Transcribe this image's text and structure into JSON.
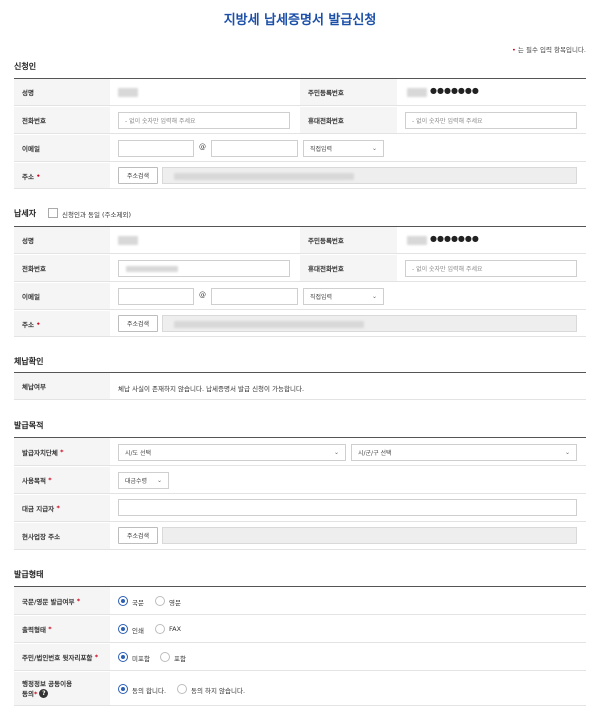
{
  "title": "지방세 납세증명서 발급신청",
  "required_note": {
    "marker": "•",
    "text": "는 필수 입력 항목입니다."
  },
  "applicant": {
    "section": "신청인",
    "name_label": "성명",
    "rrn_label": "주민등록번호",
    "rrn_mask": "●●●●●●●",
    "phone_label": "전화번호",
    "phone_placeholder": "- 없이 숫자만 입력해 주세요",
    "mobile_label": "휴대전화번호",
    "mobile_placeholder": "- 없이 숫자만 입력해 주세요",
    "email_label": "이메일",
    "email_at": "@",
    "email_domain_select": "직접입력",
    "address_label": "주소",
    "address_required": "•",
    "address_button": "주소검색"
  },
  "taxpayer": {
    "section": "납세자",
    "same_as_label": "신청인과 동일 (주소제외)",
    "name_label": "성명",
    "rrn_label": "주민등록번호",
    "rrn_mask": "●●●●●●●",
    "phone_label": "전화번호",
    "mobile_label": "휴대전화번호",
    "mobile_placeholder": "- 없이 숫자만 입력해 주세요",
    "email_label": "이메일",
    "email_at": "@",
    "email_domain_select": "직접입력",
    "address_label": "주소",
    "address_required": "•",
    "address_button": "주소검색"
  },
  "arrears": {
    "section": "체납확인",
    "label": "체납여부",
    "value": "체납 사실이 존재하지 않습니다. 납세증명서 발급 신청이 가능합니다."
  },
  "purpose": {
    "section": "발급목적",
    "region_label": "발급자치단체",
    "sido_select": "시/도 선택",
    "sigungu_select": "시/군/구 선택",
    "use_label": "사용목적",
    "use_select": "대금수령",
    "payer_label": "대금 지급자",
    "site_label": "현사업장 주소",
    "site_button": "주소검색",
    "required": "*"
  },
  "issue_form": {
    "section": "발급형태",
    "required": "*",
    "lang_label": "국문/영문 발급여부",
    "lang_options": [
      "국문",
      "영문"
    ],
    "output_label": "출력형태",
    "output_options": [
      "인쇄",
      "FAX"
    ],
    "rrn_label": "주민/법인번호 뒷자리포함",
    "rrn_options": [
      "미포함",
      "포함"
    ],
    "share_label_line1": "행정정보 공동이용",
    "share_label_line2": "동의",
    "share_help": "?",
    "share_options": [
      "동의 합니다.",
      "동의 하지 않습니다."
    ]
  },
  "colors": {
    "accent": "#1b4fa8",
    "radio": "#2d5fb3",
    "required": "#d0021b"
  },
  "chevron_icon": "⌄"
}
